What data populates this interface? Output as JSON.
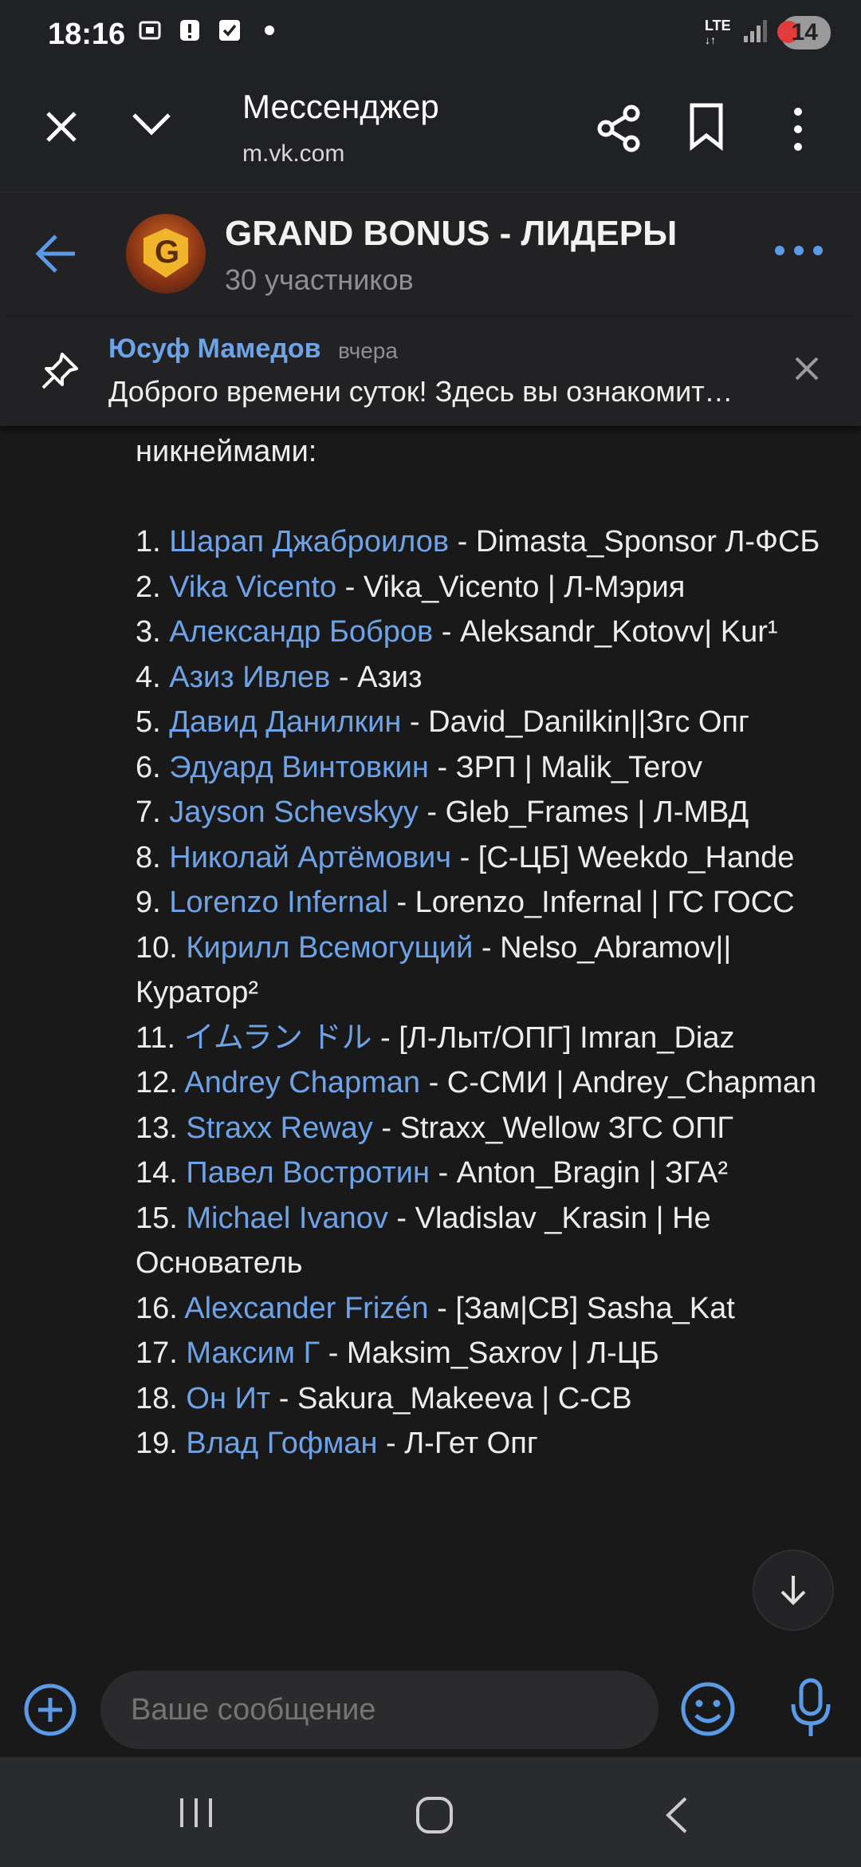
{
  "status_bar": {
    "time": "18:16",
    "network": "LTE",
    "battery": "14",
    "icons": [
      "screenshot-icon",
      "alert-icon",
      "check-icon",
      "dot-icon",
      "signal-icon"
    ]
  },
  "browser": {
    "title": "Мессенджер",
    "url": "m.vk.com"
  },
  "chat": {
    "title": "GRAND BONUS - ЛИДЕРЫ",
    "subtitle": "30 участников"
  },
  "pinned": {
    "author": "Юсуф Мамедов",
    "time": "вчера",
    "text": "Доброго времени суток! Здесь вы ознакомитесь"
  },
  "message": {
    "intro": "никнеймами:",
    "items": [
      {
        "num": "1.",
        "name": "Шарап Джаброилов",
        "rest": " - Dimasta_Sponsor Л-ФСБ"
      },
      {
        "num": "2.",
        "name": "Vika Vicento",
        "rest": " - Vika_Vicento | Л-Мэрия"
      },
      {
        "num": "3.",
        "name": "Александр Бобров",
        "rest": " - Aleksandr_Kotovv| Kur¹"
      },
      {
        "num": "4.",
        "name": "Азиз Ивлев",
        "rest": " - Азиз"
      },
      {
        "num": "5.",
        "name": "Давид Данилкин",
        "rest": " - David_Danilkin||Згс Опг"
      },
      {
        "num": "6.",
        "name": "Эдуард Винтовкин",
        "rest": " - ЗРП | Malik_Terov"
      },
      {
        "num": "7.",
        "name": "Jayson Schevskyy",
        "rest": " - Gleb_Frames | Л-МВД"
      },
      {
        "num": "8.",
        "name": "Николай Артёмович",
        "rest": " - [С-ЦБ] Weekdo_Hande"
      },
      {
        "num": "9.",
        "name": "Lorenzo Infernal",
        "rest": " - Lorenzo_Infernal | ГС ГОСС"
      },
      {
        "num": "10.",
        "name": "Кирилл Всемогущий",
        "rest": " - Nelso_Abramov|| Куратор²"
      },
      {
        "num": "11.",
        "name": "イムラン ドル",
        "rest": " - [Л-Лыт/ОПГ] Imran_Diaz"
      },
      {
        "num": "12.",
        "name": "Andrey Chapman",
        "rest": " - С-СМИ | Andrey_Chapman"
      },
      {
        "num": "13.",
        "name": "Straxx Reway",
        "rest": " - Straxx_Wellow ЗГС ОПГ"
      },
      {
        "num": "14.",
        "name": "Павел Вострoтин",
        "rest": " - Anton_Bragin | ЗГА²"
      },
      {
        "num": "15.",
        "name": "Michael Ivanov",
        "rest": " - Vladislav _Krasin | Не Основатель"
      },
      {
        "num": "16.",
        "name": "Alexcander Frizén",
        "rest": " - [Зам|СВ] Sasha_Kat"
      },
      {
        "num": "17.",
        "name": "Максим Г",
        "rest": " - Maksim_Saxrov | Л-ЦБ"
      },
      {
        "num": "18.",
        "name": "Он Ит",
        "rest": " - Sakura_Makeeva | С-СВ"
      },
      {
        "num": "19.",
        "name": "Влад Гофман",
        "rest": " - Л-Гет Опг"
      }
    ]
  },
  "composer": {
    "placeholder": "Ваше сообщение"
  }
}
